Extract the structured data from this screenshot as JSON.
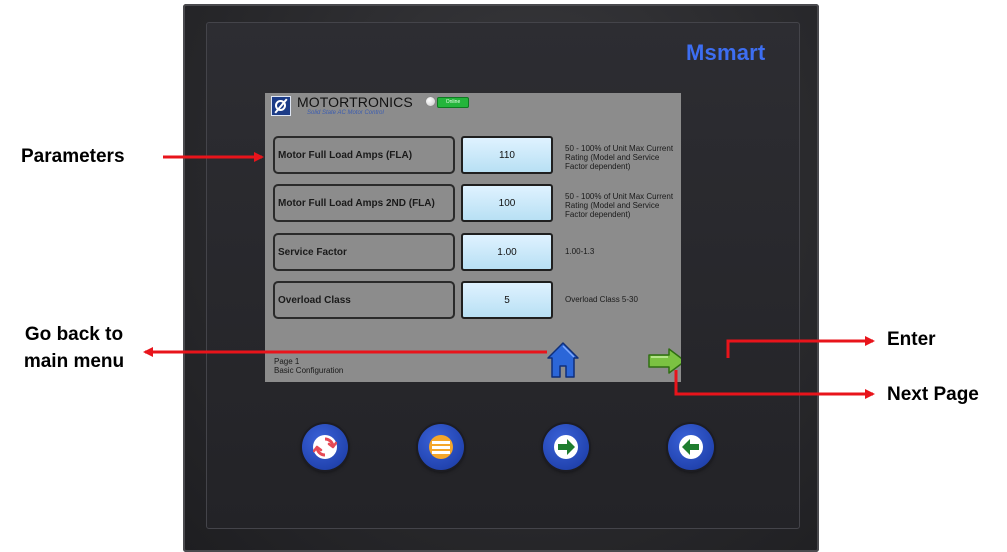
{
  "device": {
    "brand": "Msmart"
  },
  "screen": {
    "company": "MOTORTRONICS",
    "tagline": "Solid State AC Motor Control",
    "status": "Online",
    "rows": [
      {
        "parameter": "Motor Full Load Amps (FLA)",
        "value": "110",
        "description": "50 - 100% of Unit Max Current Rating (Model and Service Factor dependent)"
      },
      {
        "parameter": "Motor Full Load Amps 2ND (FLA)",
        "value": "100",
        "description": "50 - 100% of Unit Max Current Rating (Model and Service Factor dependent)"
      },
      {
        "parameter": "Service Factor",
        "value": "1.00",
        "description": "1.00-1.3"
      },
      {
        "parameter": "Overload Class",
        "value": "5",
        "description": "Overload Class 5-30"
      }
    ],
    "page_number": "Page 1",
    "page_name": "Basic Configuration"
  },
  "annotations": {
    "parameters": "Parameters",
    "go_back_line1": "Go back to",
    "go_back_line2": "main menu",
    "enter": "Enter",
    "next_page": "Next Page"
  },
  "colors": {
    "brand_blue": "#3d6ef2",
    "screen_gray": "#8c8c8c",
    "value_cell": "#c9e9f8",
    "status_green": "#24b53b",
    "arrow_red": "#e8141b",
    "nav_green": "#7bc242",
    "home_blue": "#2b66d8"
  },
  "icons": {
    "home": "home-icon",
    "next": "arrow-right-icon",
    "enter": "enter-return-icon",
    "hw_buttons": [
      "refresh-icon",
      "menu-icon",
      "arrow-right-icon",
      "arrow-left-icon"
    ]
  }
}
